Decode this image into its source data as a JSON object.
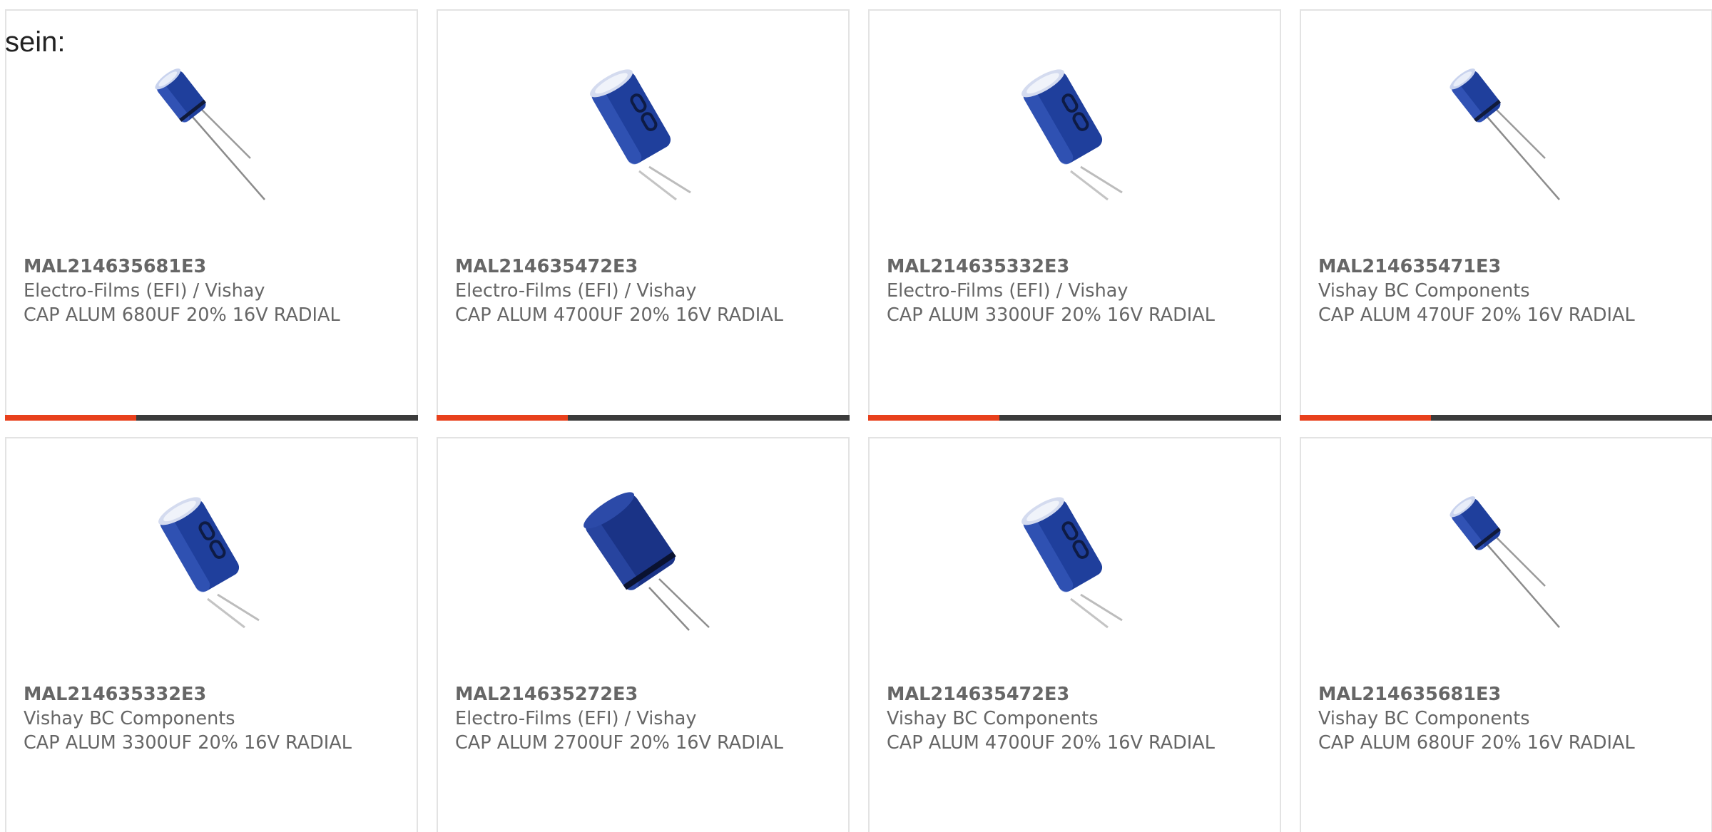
{
  "intro_text": "sein:",
  "colors": {
    "accent": "#e8401c",
    "bar": "#3b3b3b",
    "text": "#666666",
    "border": "#e3e3e3",
    "capacitor_body": "#1f3f9c"
  },
  "products": [
    {
      "part_number": "MAL214635681E3",
      "manufacturer": "Electro-Films (EFI) / Vishay",
      "description": "CAP ALUM 680UF 20% 16V RADIAL",
      "image_icon": "capacitor-small-icon"
    },
    {
      "part_number": "MAL214635472E3",
      "manufacturer": "Electro-Films (EFI) / Vishay",
      "description": "CAP ALUM 4700UF 20% 16V RADIAL",
      "image_icon": "capacitor-large-icon"
    },
    {
      "part_number": "MAL214635332E3",
      "manufacturer": "Electro-Films (EFI) / Vishay",
      "description": "CAP ALUM 3300UF 20% 16V RADIAL",
      "image_icon": "capacitor-large-icon"
    },
    {
      "part_number": "MAL214635471E3",
      "manufacturer": "Vishay BC Components",
      "description": "CAP ALUM 470UF 20% 16V RADIAL",
      "image_icon": "capacitor-small-icon"
    },
    {
      "part_number": "MAL214635332E3",
      "manufacturer": "Vishay BC Components",
      "description": "CAP ALUM 3300UF 20% 16V RADIAL",
      "image_icon": "capacitor-large-icon"
    },
    {
      "part_number": "MAL214635272E3",
      "manufacturer": "Electro-Films (EFI) / Vishay",
      "description": "CAP ALUM 2700UF 20% 16V RADIAL",
      "image_icon": "capacitor-dark-icon"
    },
    {
      "part_number": "MAL214635472E3",
      "manufacturer": "Vishay BC Components",
      "description": "CAP ALUM 4700UF 20% 16V RADIAL",
      "image_icon": "capacitor-large-icon"
    },
    {
      "part_number": "MAL214635681E3",
      "manufacturer": "Vishay BC Components",
      "description": "CAP ALUM 680UF 20% 16V RADIAL",
      "image_icon": "capacitor-small-icon"
    }
  ]
}
